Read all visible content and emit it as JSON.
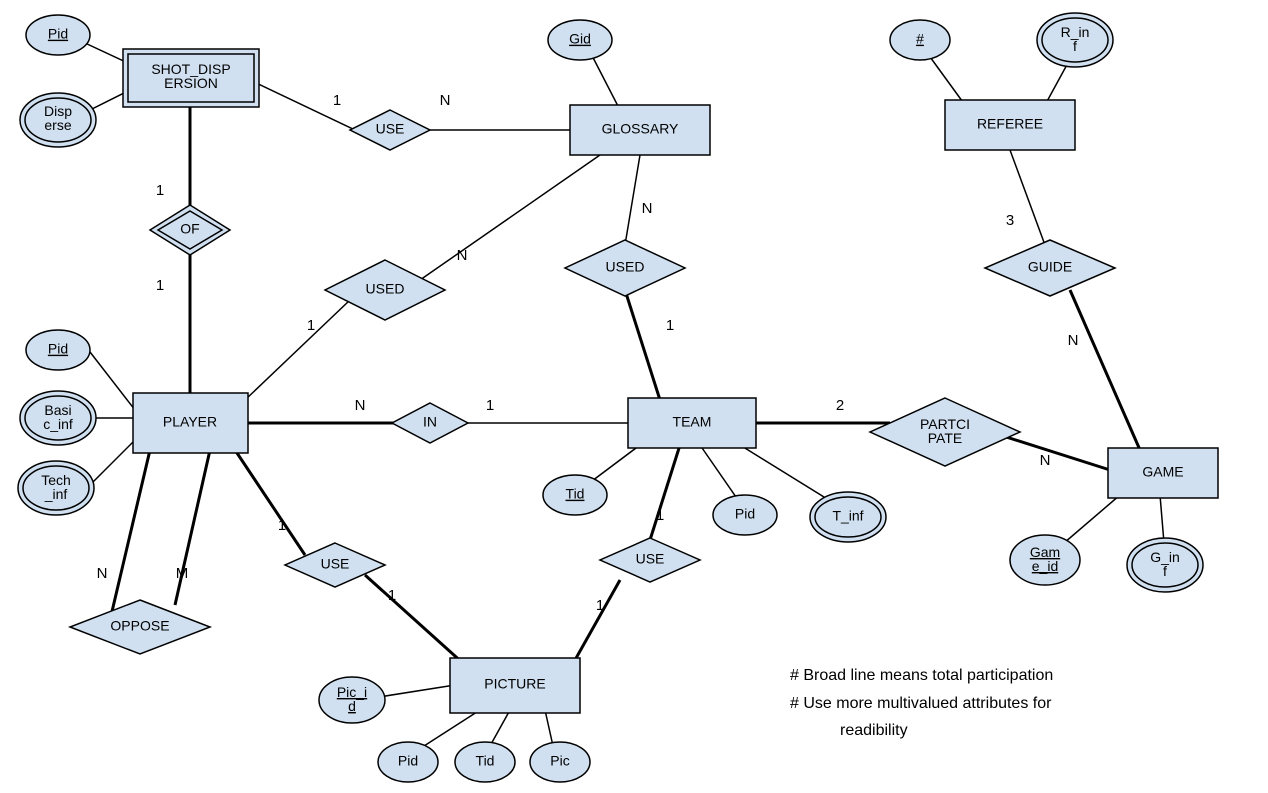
{
  "entities": {
    "shot_dispersion": "SHOT_DISP\nERSION",
    "glossary": "GLOSSARY",
    "referee": "REFEREE",
    "player": "PLAYER",
    "team": "TEAM",
    "game": "GAME",
    "picture": "PICTURE"
  },
  "relationships": {
    "use1": "USE",
    "of": "OF",
    "used1": "USED",
    "used2": "USED",
    "in": "IN",
    "participate": "PARTCI\nPATE",
    "guide": "GUIDE",
    "oppose": "OPPOSE",
    "use2": "USE",
    "use3": "USE"
  },
  "attributes": {
    "pid_sd": "Pid",
    "disperse": "Disp\nerse",
    "gid": "Gid",
    "ref_num": "#",
    "r_inf": "R_in\nf",
    "pid_player": "Pid",
    "basic_inf": "Basi\nc_inf",
    "tech_inf": "Tech\n_inf",
    "tid": "Tid",
    "pid_team": "Pid",
    "t_inf": "T_inf",
    "game_id": "Gam\ne_id",
    "g_inf": "G_in\nf",
    "pic_id": "Pic_i\nd",
    "pid_pic": "Pid",
    "tid_pic": "Tid",
    "pic": "Pic"
  },
  "cardinalities": {
    "c1": "1",
    "cN": "N",
    "cM": "M",
    "c2": "2",
    "c3": "3"
  },
  "notes": {
    "n1": "# Broad line means  total participation",
    "n2": "# Use more multivalued attributes for",
    "n3": "readibility"
  }
}
